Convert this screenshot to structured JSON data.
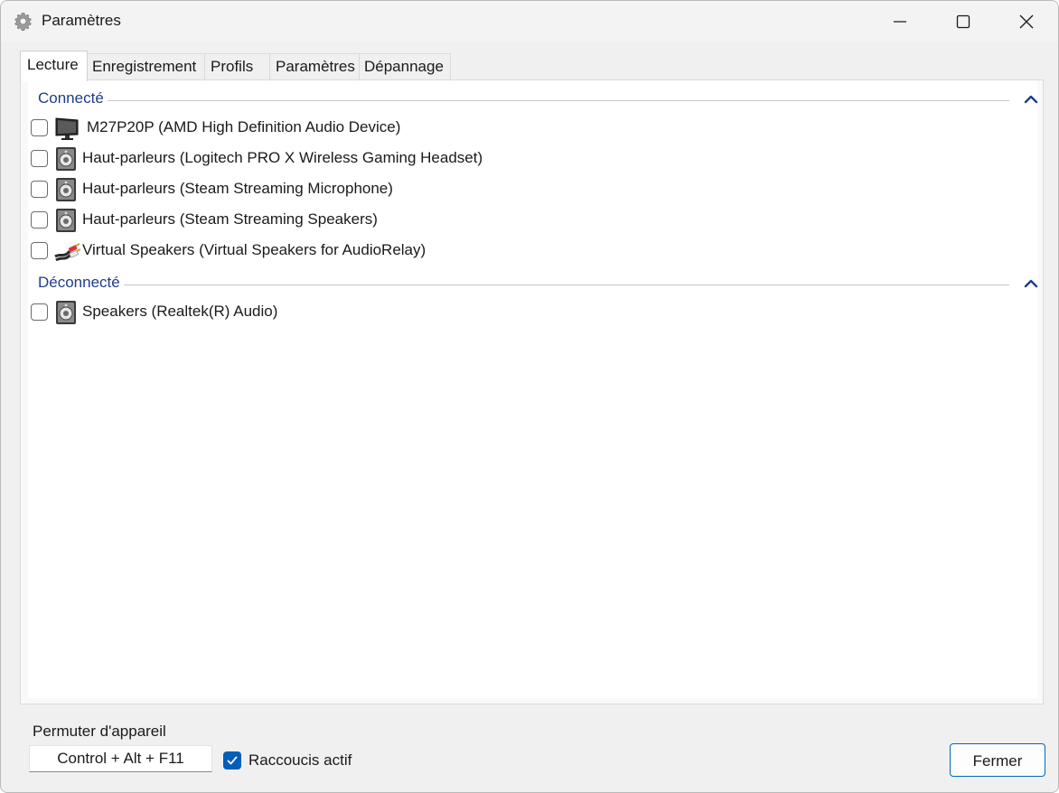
{
  "window": {
    "title": "Paramètres"
  },
  "tabs": [
    {
      "label": "Lecture",
      "active": true
    },
    {
      "label": "Enregistrement",
      "active": false
    },
    {
      "label": "Profils",
      "active": false
    },
    {
      "label": "Paramètres",
      "active": false
    },
    {
      "label": "Dépannage",
      "active": false
    }
  ],
  "groups": {
    "connected": {
      "label": "Connecté",
      "devices": [
        {
          "label": "M27P20P (AMD High Definition Audio Device)",
          "icon": "monitor-icon",
          "checked": false
        },
        {
          "label": "Haut-parleurs (Logitech PRO X Wireless Gaming Headset)",
          "icon": "speaker-icon",
          "checked": false
        },
        {
          "label": "Haut-parleurs (Steam Streaming Microphone)",
          "icon": "speaker-icon",
          "checked": false
        },
        {
          "label": "Haut-parleurs (Steam Streaming Speakers)",
          "icon": "speaker-icon",
          "checked": false
        },
        {
          "label": "Virtual Speakers (Virtual Speakers for AudioRelay)",
          "icon": "rca-cable-icon",
          "checked": false
        }
      ]
    },
    "disconnected": {
      "label": "Déconnecté",
      "devices": [
        {
          "label": "Speakers (Realtek(R) Audio)",
          "icon": "speaker-icon",
          "checked": false
        }
      ]
    }
  },
  "footer": {
    "hotkey_label": "Permuter d'appareil",
    "hotkey_value": "Control + Alt + F11",
    "shortcut_checkbox_label": "Raccoucis actif",
    "shortcut_checked": true,
    "close_label": "Fermer"
  },
  "colors": {
    "group_header": "#1f3d8c",
    "accent": "#005fb8"
  }
}
